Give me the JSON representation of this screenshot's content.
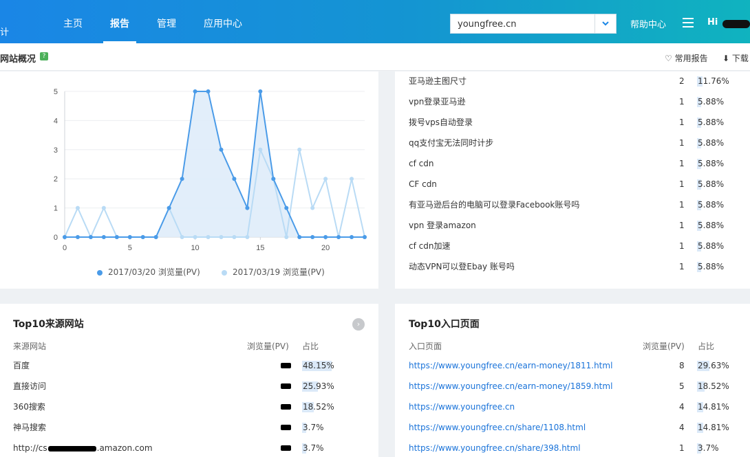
{
  "nav": {
    "brand_fragment": "计",
    "items": [
      {
        "label": "主页",
        "active": false
      },
      {
        "label": "报告",
        "active": true
      },
      {
        "label": "管理",
        "active": false
      },
      {
        "label": "应用中心",
        "active": false
      }
    ],
    "site_select_value": "youngfree.cn",
    "help_label": "帮助中心",
    "greeting": "Hi",
    "menu_icon": "hamburger-icon",
    "colors": {
      "accent_start": "#1a86e6",
      "accent_end": "#10b3bf"
    }
  },
  "subheader": {
    "title": "网站概况",
    "badge": "?",
    "favorite_label": "常用报告",
    "download_label": "下载"
  },
  "trend": {
    "legend": [
      "2017/03/20 浏览量(PV)",
      "2017/03/19 浏览量(PV)"
    ]
  },
  "chart_data": {
    "type": "line",
    "x": [
      0,
      1,
      2,
      3,
      4,
      5,
      6,
      7,
      8,
      9,
      10,
      11,
      12,
      13,
      14,
      15,
      16,
      17,
      18,
      19,
      20,
      21,
      22,
      23
    ],
    "xticks": [
      "0",
      "5",
      "10",
      "15",
      "20"
    ],
    "yticks": [
      "0",
      "1",
      "2",
      "3",
      "4",
      "5"
    ],
    "ylim": [
      0,
      5
    ],
    "xlim": [
      0,
      23
    ],
    "grid": true,
    "legend_position": "bottom",
    "series": [
      {
        "name": "2017/03/20 浏览量(PV)",
        "color": "#4a9be8",
        "filled": true,
        "values": [
          0,
          0,
          0,
          0,
          0,
          0,
          0,
          0,
          1,
          2,
          5,
          5,
          3,
          2,
          1,
          5,
          2,
          1,
          0,
          0,
          0,
          0,
          0,
          0
        ]
      },
      {
        "name": "2017/03/19 浏览量(PV)",
        "color": "#b9dbf5",
        "filled": false,
        "values": [
          0,
          1,
          0,
          1,
          0,
          0,
          0,
          0,
          1,
          0,
          0,
          0,
          0,
          0,
          0,
          3,
          2,
          0,
          3,
          1,
          2,
          0,
          2,
          0
        ]
      }
    ]
  },
  "keywords": [
    {
      "word": "亚马逊主图尺寸",
      "count": "2",
      "pct": "11.76%",
      "ratio": 0.1176
    },
    {
      "word": "vpn登录亚马逊",
      "count": "1",
      "pct": "5.88%",
      "ratio": 0.0588
    },
    {
      "word": "拨号vps自动登录",
      "count": "1",
      "pct": "5.88%",
      "ratio": 0.0588
    },
    {
      "word": "qq支付宝无法同时计步",
      "count": "1",
      "pct": "5.88%",
      "ratio": 0.0588
    },
    {
      "word": "cf cdn",
      "count": "1",
      "pct": "5.88%",
      "ratio": 0.0588
    },
    {
      "word": "CF cdn",
      "count": "1",
      "pct": "5.88%",
      "ratio": 0.0588
    },
    {
      "word": "有亚马逊后台的电脑可以登录Facebook账号吗",
      "count": "1",
      "pct": "5.88%",
      "ratio": 0.0588
    },
    {
      "word": "vpn 登录amazon",
      "count": "1",
      "pct": "5.88%",
      "ratio": 0.0588
    },
    {
      "word": "cf cdn加速",
      "count": "1",
      "pct": "5.88%",
      "ratio": 0.0588
    },
    {
      "word": "动态VPN可以登Ebay 账号吗",
      "count": "1",
      "pct": "5.88%",
      "ratio": 0.0588
    }
  ],
  "sources": {
    "title": "Top10来源网站",
    "headers": {
      "site": "来源网站",
      "pv": "浏览量(PV)",
      "ratio": "占比"
    },
    "rows": [
      {
        "site": "百度",
        "pct": "48.15%",
        "ratio": 0.4815
      },
      {
        "site": "直接访问",
        "pct": "25.93%",
        "ratio": 0.2593
      },
      {
        "site": "360搜索",
        "pct": "18.52%",
        "ratio": 0.1852
      },
      {
        "site": "神马搜索",
        "pct": "3.7%",
        "ratio": 0.037
      },
      {
        "site": "http://cs",
        "site_suffix": ".amazon.com",
        "pct": "3.7%",
        "ratio": 0.037
      }
    ]
  },
  "entries": {
    "title": "Top10入口页面",
    "headers": {
      "page": "入口页面",
      "pv": "浏览量(PV)",
      "ratio": "占比"
    },
    "rows": [
      {
        "url": "https://www.youngfree.cn/earn-money/1811.html",
        "count": "8",
        "pct": "29.63%",
        "ratio": 0.2963
      },
      {
        "url": "https://www.youngfree.cn/earn-money/1859.html",
        "count": "5",
        "pct": "18.52%",
        "ratio": 0.1852
      },
      {
        "url": "https://www.youngfree.cn",
        "count": "4",
        "pct": "14.81%",
        "ratio": 0.1481
      },
      {
        "url": "https://www.youngfree.cn/share/1108.html",
        "count": "4",
        "pct": "14.81%",
        "ratio": 0.1481
      },
      {
        "url": "https://www.youngfree.cn/share/398.html",
        "count": "1",
        "pct": "3.7%",
        "ratio": 0.037
      }
    ]
  }
}
